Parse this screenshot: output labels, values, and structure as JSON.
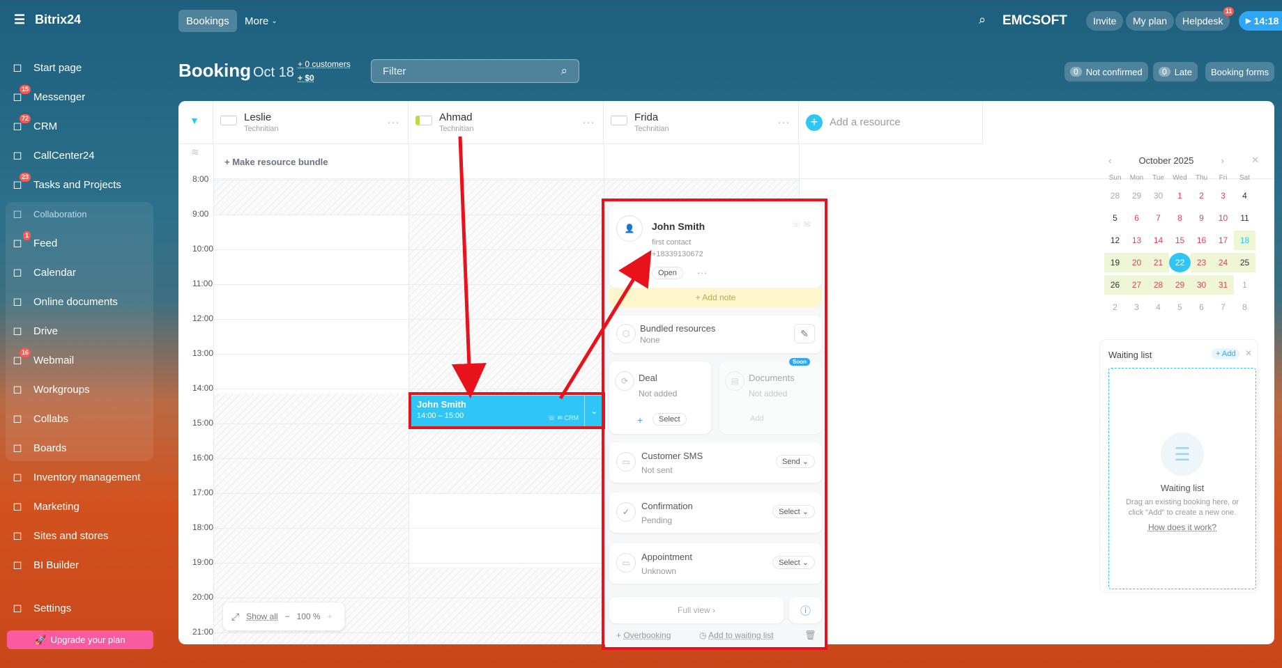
{
  "app": {
    "name": "Bitrix24",
    "clock": "14:18",
    "company": "EMCSOFT"
  },
  "top_nav": {
    "tabs": [
      {
        "label": "Bookings"
      },
      {
        "label": "More"
      }
    ],
    "invite": "Invite",
    "my_plan": "My plan",
    "helpdesk": "Helpdesk",
    "helpdesk_badge": "11"
  },
  "sidebar": {
    "items": [
      {
        "label": "Start page",
        "icon": "home-icon",
        "badge": ""
      },
      {
        "label": "Messenger",
        "icon": "chat-icon",
        "badge": "15"
      },
      {
        "label": "CRM",
        "icon": "crm-icon",
        "badge": "72"
      },
      {
        "label": "CallCenter24",
        "icon": "callcenter-icon",
        "badge": ""
      },
      {
        "label": "Tasks and Projects",
        "icon": "tasks-icon",
        "badge": "23"
      },
      {
        "label": "Collaboration",
        "icon": "collab-icon",
        "badge": ""
      },
      {
        "label": "Feed",
        "icon": "feed-icon",
        "badge": "1"
      },
      {
        "label": "Calendar",
        "icon": "calendar-icon",
        "badge": ""
      },
      {
        "label": "Online documents",
        "icon": "documents-icon",
        "badge": ""
      },
      {
        "label": "Drive",
        "icon": "drive-icon",
        "badge": ""
      },
      {
        "label": "Webmail",
        "icon": "mail-icon",
        "badge": "16"
      },
      {
        "label": "Workgroups",
        "icon": "workgroups-icon",
        "badge": ""
      },
      {
        "label": "Collabs",
        "icon": "collabs-icon",
        "badge": ""
      },
      {
        "label": "Boards",
        "icon": "boards-icon",
        "badge": ""
      },
      {
        "label": "Inventory management",
        "icon": "inventory-icon",
        "badge": ""
      },
      {
        "label": "Marketing",
        "icon": "marketing-icon",
        "badge": ""
      },
      {
        "label": "Sites and stores",
        "icon": "cart-icon",
        "badge": ""
      },
      {
        "label": "BI Builder",
        "icon": "bi-icon",
        "badge": ""
      },
      {
        "label": "Settings",
        "icon": "gear-icon",
        "badge": ""
      }
    ],
    "upgrade": "Upgrade your plan"
  },
  "booking": {
    "title": "Booking",
    "date": "Oct 18",
    "customers": "+ 0 customers",
    "amount": "+ $0",
    "filter_placeholder": "Filter",
    "not_confirmed": {
      "count": "0",
      "label": "Not confirmed"
    },
    "late": {
      "count": "0",
      "label": "Late"
    },
    "forms": "Booking forms"
  },
  "resources": [
    {
      "name": "Leslie",
      "role": "Technitian"
    },
    {
      "name": "Ahmad",
      "role": "Technitian"
    },
    {
      "name": "Frida",
      "role": "Technitian"
    }
  ],
  "add_resource": "Add a resource",
  "make_bundle": "+ Make resource bundle",
  "times": [
    "8:00",
    "9:00",
    "10:00",
    "11:00",
    "12:00",
    "13:00",
    "14:00",
    "15:00",
    "16:00",
    "17:00",
    "18:00",
    "19:00",
    "20:00",
    "21:00"
  ],
  "event": {
    "name": "John Smith",
    "time": "14:00 – 15:00",
    "crm": "CRM"
  },
  "zoom": {
    "show_all": "Show all",
    "value": "100 %"
  },
  "popup": {
    "client_name": "John Smith",
    "client_type": "first contact",
    "phone": "+18339130672",
    "open": "Open",
    "add_note": "+ Add note",
    "bundled": {
      "title": "Bundled resources",
      "value": "None"
    },
    "deal": {
      "title": "Deal",
      "value": "Not added",
      "action": "Select"
    },
    "documents": {
      "title": "Documents",
      "value": "Not added",
      "action": "Add",
      "badge": "Soon"
    },
    "sms": {
      "title": "Customer SMS",
      "value": "Not sent",
      "action": "Send"
    },
    "confirmation": {
      "title": "Confirmation",
      "value": "Pending",
      "action": "Select"
    },
    "appointment": {
      "title": "Appointment",
      "value": "Unknown",
      "action": "Select"
    },
    "full_view": "Full view",
    "overbooking": "Overbooking",
    "waiting": "Add to waiting list"
  },
  "calendar": {
    "month": "October 2025",
    "weekdays": [
      "Sun",
      "Mon",
      "Tue",
      "Wed",
      "Thu",
      "Fri",
      "Sat"
    ],
    "days": [
      "28",
      "29",
      "30",
      "1",
      "2",
      "3",
      "4",
      "5",
      "6",
      "7",
      "8",
      "9",
      "10",
      "11",
      "12",
      "13",
      "14",
      "15",
      "16",
      "17",
      "18",
      "19",
      "20",
      "21",
      "22",
      "23",
      "24",
      "25",
      "26",
      "27",
      "28",
      "29",
      "30",
      "31",
      "1",
      "2",
      "3",
      "4",
      "5",
      "6",
      "7",
      "8"
    ],
    "selected": "22"
  },
  "waiting_list": {
    "title": "Waiting list",
    "add": "+ Add",
    "empty_title": "Waiting list",
    "empty_text": "Drag an existing booking here, or click \"Add\" to create a new one.",
    "link": "How does it work?"
  }
}
